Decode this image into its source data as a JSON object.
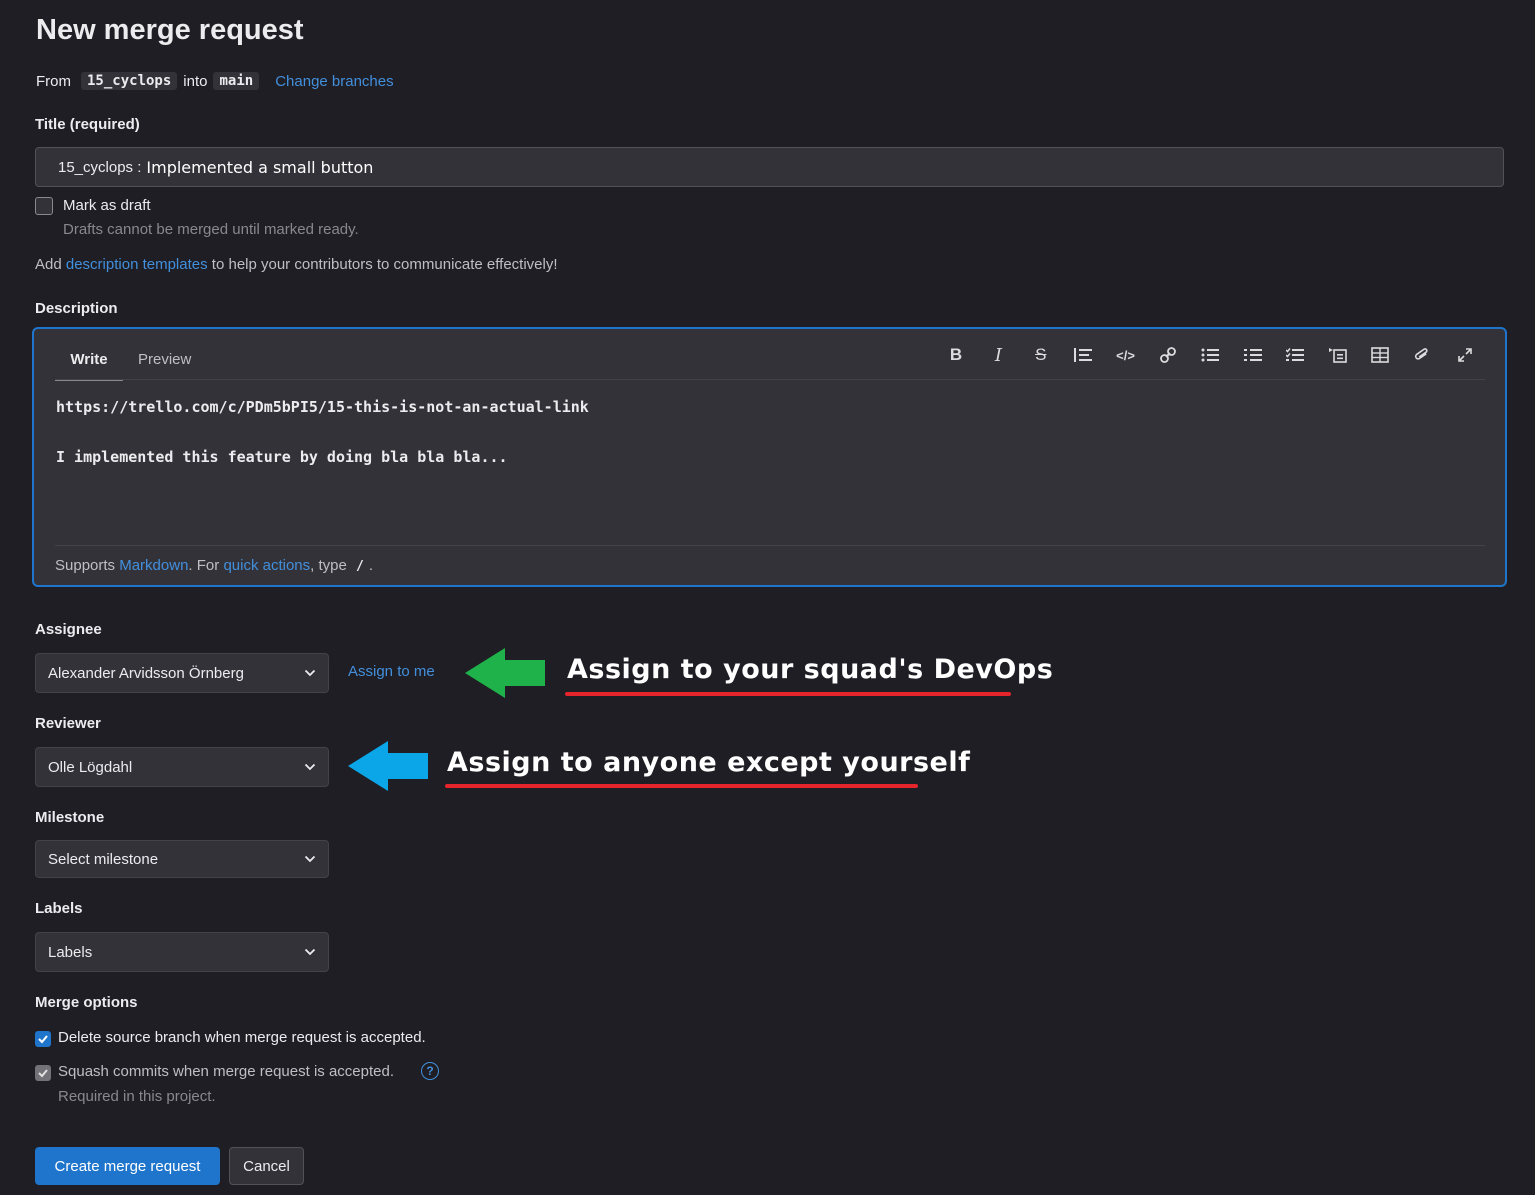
{
  "header": {
    "title": "New merge request",
    "from_label": "From",
    "source_branch": "15_cyclops",
    "into_label": "into",
    "target_branch": "main",
    "change_branches": "Change branches"
  },
  "title_field": {
    "label": "Title (required)",
    "prefix": "15_cyclops :",
    "value": "Implemented a small button"
  },
  "draft": {
    "label": "Mark as draft",
    "help": "Drafts cannot be merged until marked ready.",
    "checked": false
  },
  "templates_hint": {
    "prefix": "Add",
    "link": "description templates",
    "suffix": "to help your contributors to communicate effectively!"
  },
  "description": {
    "label": "Description",
    "tabs": [
      "Write",
      "Preview"
    ],
    "active_tab": "Write",
    "toolbar_icons": [
      "bold-icon",
      "italic-icon",
      "strikethrough-icon",
      "quote-icon",
      "code-icon",
      "link-icon",
      "bulleted-list-icon",
      "numbered-list-icon",
      "task-list-icon",
      "collapsible-section-icon",
      "table-icon",
      "attach-file-icon",
      "fullscreen-icon"
    ],
    "lines": [
      "https://trello.com/c/PDm5bPI5/15-this-is-not-an-actual-link",
      "",
      "I implemented this feature by doing bla bla bla..."
    ],
    "footer": {
      "supports": "Supports",
      "markdown": "Markdown",
      "for": ". For",
      "quick_actions": "quick actions",
      "type": ", type",
      "slash": "/",
      "end": "."
    }
  },
  "assignee": {
    "label": "Assignee",
    "value": "Alexander Arvidsson Örnberg",
    "assign_to_me": "Assign to me"
  },
  "reviewer": {
    "label": "Reviewer",
    "value": "Olle Lögdahl"
  },
  "milestone": {
    "label": "Milestone",
    "value": "Select milestone"
  },
  "labels": {
    "label": "Labels",
    "value": "Labels"
  },
  "merge_options": {
    "label": "Merge options",
    "delete_branch": "Delete source branch when merge request is accepted.",
    "squash": "Squash commits when merge request is accepted.",
    "squash_help": "Required in this project."
  },
  "actions": {
    "create": "Create merge request",
    "cancel": "Cancel"
  },
  "annotations": {
    "devops": "Assign to your squad's DevOps",
    "anyone": "Assign to anyone except yourself",
    "green_arrow_color": "#1fb24a",
    "blue_arrow_color": "#0aa6e8",
    "underline_color": "#e5242b"
  },
  "colors": {
    "background": "#1f1e24",
    "link": "#428fdc",
    "primary_button": "#1f75cb",
    "focus_border": "#1f75cb"
  }
}
